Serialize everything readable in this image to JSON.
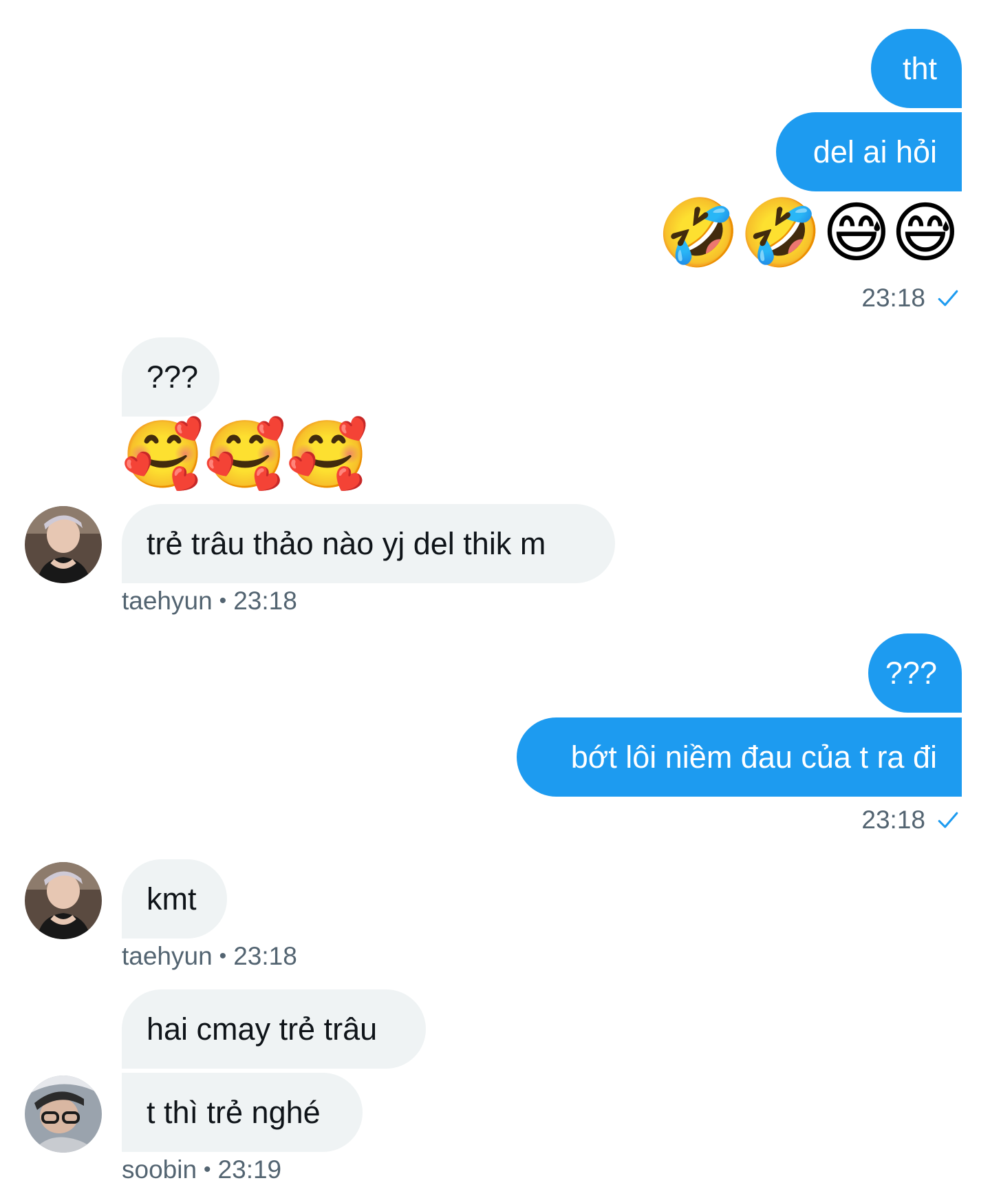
{
  "messages": {
    "m1": "tht",
    "m2": "del ai hỏi",
    "m3_emoji": "🤣🤣😅😅",
    "m3_time": "23:18",
    "m4": "???",
    "m5_emoji": "🥰🥰🥰",
    "m6": "trẻ trâu thảo nào yj del thik m",
    "m6_sender": "taehyun",
    "m6_time": "23:18",
    "m7": "???",
    "m8": "bớt lôi niềm đau của t ra đi",
    "m8_time": "23:18",
    "m9": "kmt",
    "m9_sender": "taehyun",
    "m9_time": "23:18",
    "m10": "hai cmay trẻ trâu",
    "m11": "t thì trẻ nghé",
    "m11_sender": "soobin",
    "m11_time": "23:19"
  },
  "separator": "•",
  "colors": {
    "outgoing_bubble": "#1d9bf0",
    "incoming_bubble": "#eff3f4",
    "meta_text": "#536471",
    "check": "#1d9bf0"
  },
  "icons": {
    "read_receipt": "check-icon",
    "avatar_taehyun": "avatar",
    "avatar_soobin": "avatar"
  }
}
